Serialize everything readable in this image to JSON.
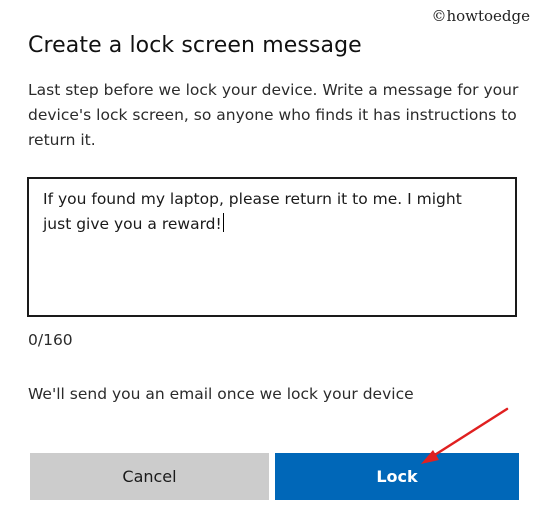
{
  "watermark": "©howtoedge",
  "dialog": {
    "title": "Create a lock screen message",
    "description": "Last step before we lock your device. Write a message for your device's lock screen, so anyone who finds it has instructions to return it.",
    "message": {
      "line1": "If you found my laptop, please return it to me. I might",
      "line2": "just give you a reward!"
    },
    "counter": "0/160",
    "notice": "We'll send you an email once we lock your device",
    "buttons": {
      "cancel_label": "Cancel",
      "lock_label": "Lock"
    }
  },
  "colors": {
    "primary": "#0067b8",
    "secondary": "#cccccc",
    "annotation_arrow": "#e02020"
  }
}
